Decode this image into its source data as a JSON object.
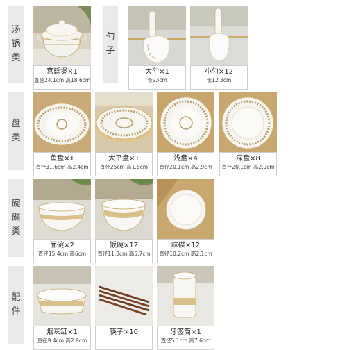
{
  "categories": [
    {
      "label": [
        "汤",
        "锅",
        "类"
      ]
    },
    {
      "label": [
        "勺",
        "子"
      ]
    },
    {
      "label": [
        "盘",
        "类"
      ]
    },
    {
      "label": [
        "碗",
        "碟",
        "类"
      ]
    },
    {
      "label": [
        "配",
        "件"
      ]
    }
  ],
  "items": [
    {
      "name": "宫廷煲×1",
      "spec": "直径24.1cm 高18.6cm"
    },
    {
      "name": "大勺×1",
      "spec": "长23cm"
    },
    {
      "name": "小勺×12",
      "spec": "长12.3cm"
    },
    {
      "name": "鱼盘×1",
      "spec": "直径31.6cm 高2.4cm"
    },
    {
      "name": "大平盘×1",
      "spec": "直径25cm 高1.8cm"
    },
    {
      "name": "浅盘×4",
      "spec": "直径20.1cm 高2.9cm"
    },
    {
      "name": "深盘×8",
      "spec": "直径20.1cm 高2.9cm"
    },
    {
      "name": "面碗×2",
      "spec": "直径15.4cm 高6cm"
    },
    {
      "name": "饭碗×12",
      "spec": "直径11.3cm 高5.7cm"
    },
    {
      "name": "味碟×12",
      "spec": "直径10.2cm 高2.1cm"
    },
    {
      "name": "烟灰缸×1",
      "spec": "直径9.4cm 高2.9cm"
    },
    {
      "name": "筷子×10",
      "spec": ""
    },
    {
      "name": "牙签筒×1",
      "spec": "直径5.1cm 高7.6cm"
    }
  ],
  "colors": {
    "panel": "#e9e9e9",
    "caption_border": "#cfcfcf",
    "gold": "#c9a86a"
  }
}
